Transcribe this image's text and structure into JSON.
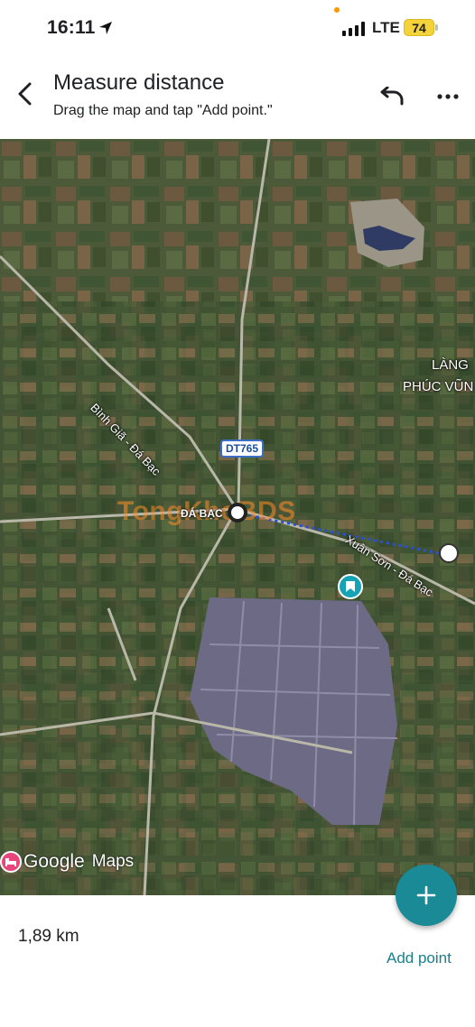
{
  "status": {
    "time": "16:11",
    "network": "LTE",
    "battery": "74"
  },
  "header": {
    "title": "Measure distance",
    "subtitle": "Drag the map and tap \"Add point.\""
  },
  "map": {
    "labels": {
      "village_line1": "LÀNG",
      "village_line2": "PHÚC VŨN",
      "road_1": "Bình Giã - Đá Bạc",
      "road_2": "Xuân Sơn - Đá Bạc",
      "town": "ĐÁ BẠC",
      "route_shield": "DT765"
    },
    "watermark": "TongKhoBDS",
    "attribution_google": "Google",
    "attribution_maps": "Maps"
  },
  "bottom": {
    "distance": "1,89 km",
    "add_point_label": "Add point",
    "fab_symbol": "+"
  },
  "colors": {
    "accent": "#1a8a96",
    "measure_line": "#2a4fd8"
  }
}
